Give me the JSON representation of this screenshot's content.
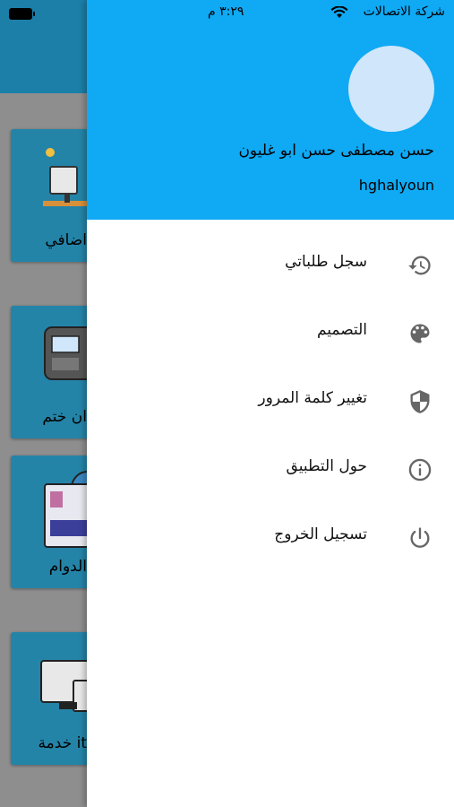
{
  "status_bar": {
    "carrier": "شركة الاتصالات",
    "time": "٣:٢٩ م"
  },
  "drawer": {
    "user_name": "حسن مصطفى حسن ابو غليون",
    "username": "hghalyoun",
    "items": [
      {
        "label": "سجل طلباتي",
        "icon": "history-icon"
      },
      {
        "label": "التصميم",
        "icon": "palette-icon"
      },
      {
        "label": "تغيير كلمة المرور",
        "icon": "shield-icon"
      },
      {
        "label": "حول التطبيق",
        "icon": "info-icon"
      },
      {
        "label": "تسجيل الخروج",
        "icon": "power-icon"
      }
    ]
  },
  "background": {
    "cards": [
      {
        "label": "اضافي"
      },
      {
        "label": "ان ختم"
      },
      {
        "label": "الدوام"
      },
      {
        "label": "خدمة it"
      }
    ]
  },
  "colors": {
    "header": "#0fa9f4",
    "avatar": "#cfe6fb",
    "app_header": "#1b7fa8",
    "card": "#2484a8"
  }
}
